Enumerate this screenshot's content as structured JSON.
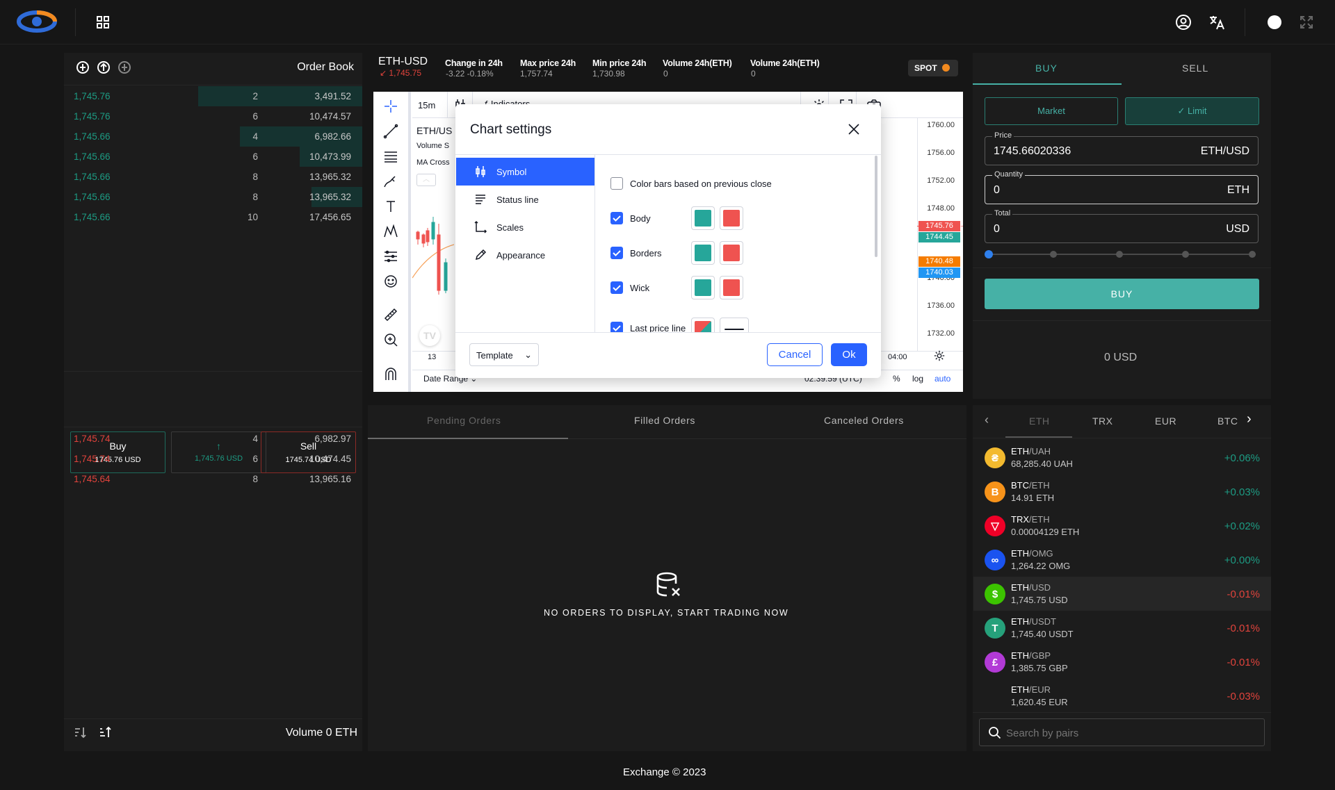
{
  "colors": {
    "green": "#1d9b83",
    "red": "#e0433c",
    "accent": "#2962ff",
    "teal": "#46b1a6"
  },
  "header": {
    "grid_icon": "grid-icon",
    "user_icon": "user-icon",
    "translate_icon": "translate-icon",
    "theme_icon": "theme-toggle",
    "expand_icon": "fullscreen-icon"
  },
  "orderbook": {
    "title": "Order Book",
    "bids": [
      {
        "price": "1,745.76",
        "qty": "2",
        "total": "3,491.52",
        "fill": 0.55
      },
      {
        "price": "1,745.76",
        "qty": "6",
        "total": "10,474.57",
        "fill": 0.0
      },
      {
        "price": "1,745.66",
        "qty": "4",
        "total": "6,982.66",
        "fill": 0.41
      },
      {
        "price": "1,745.66",
        "qty": "6",
        "total": "10,473.99",
        "fill": 0.21
      },
      {
        "price": "1,745.66",
        "qty": "8",
        "total": "13,965.32",
        "fill": 0.0
      },
      {
        "price": "1,745.66",
        "qty": "8",
        "total": "13,965.32",
        "fill": 0.17
      },
      {
        "price": "1,745.66",
        "qty": "10",
        "total": "17,456.65",
        "fill": 0.0
      }
    ],
    "asks": [
      {
        "price": "1,745.74",
        "qty": "4",
        "total": "6,982.97"
      },
      {
        "price": "1,745.74",
        "qty": "6",
        "total": "10,474.45"
      },
      {
        "price": "1,745.64",
        "qty": "8",
        "total": "13,965.16"
      }
    ],
    "buy_label": "Buy",
    "buy_price": "1745.76 USD",
    "mid_price": "1,745.76 USD",
    "sell_label": "Sell",
    "sell_price": "1745.74 USD",
    "volume": "Volume 0 ETH"
  },
  "market": {
    "pair": "ETH-USD",
    "last": "1,745.75",
    "change_label": "Change in 24h",
    "change_value": "-3.22 -0.18%",
    "max_label": "Max price 24h",
    "max_value": "1,757.74",
    "min_label": "Min price 24h",
    "min_value": "1,730.98",
    "vol_eth_label": "Volume 24h(ETH)",
    "vol_eth_value": "0",
    "vol2_label": "Volume 24h(ETH)",
    "vol2_value": "0",
    "spot": "SPOT"
  },
  "chart": {
    "interval": "15m",
    "indicators": "Indicators",
    "symbol": "ETH/US",
    "volume_label": "Volume S",
    "ma_label": "MA Cross",
    "ticks": [
      "1760.00",
      "1756.00",
      "1752.00",
      "1748.00",
      "1740.00",
      "1736.00",
      "1732.00"
    ],
    "tag_red": "1745.76",
    "tag_green": "1744.45",
    "tag_orange": "1740.48",
    "tag_blue": "1740.03",
    "x_left": "13",
    "x_right": "04:00",
    "date_range": "Date Range",
    "time_utc": "02:39:59 (UTC)",
    "pct": "%",
    "log": "log",
    "auto": "auto"
  },
  "dialog": {
    "title": "Chart settings",
    "nav": [
      "Symbol",
      "Status line",
      "Scales",
      "Appearance"
    ],
    "opt_color_bars": "Color bars based on previous close",
    "opt_body": "Body",
    "opt_borders": "Borders",
    "opt_wick": "Wick",
    "opt_last": "Last price line",
    "template": "Template",
    "cancel": "Cancel",
    "ok": "Ok"
  },
  "orders": {
    "tabs": [
      "Pending Orders",
      "Filled Orders",
      "Canceled Orders"
    ],
    "empty": "NO ORDERS TO DISPLAY, START TRADING NOW"
  },
  "trade": {
    "buy_tab": "BUY",
    "sell_tab": "SELL",
    "market": "Market",
    "limit": "Limit",
    "price_label": "Price",
    "price_value": "1745.66020336",
    "price_unit": "ETH/USD",
    "qty_label": "Quantity",
    "qty_value": "0",
    "qty_unit": "ETH",
    "total_label": "Total",
    "total_value": "0",
    "total_unit": "USD",
    "slider": 0,
    "buy_button": "BUY",
    "balance": "0 USD"
  },
  "markets": {
    "tabs": [
      "ETH",
      "TRX",
      "EUR",
      "BTC"
    ],
    "pairs": [
      {
        "base": "ETH",
        "quote": "/UAH",
        "price": "68,285.40 UAH",
        "change": "+0.06%",
        "up": true,
        "color": "#f3ba2f",
        "icon": "uah-coin-icon",
        "glyph": "₴"
      },
      {
        "base": "BTC",
        "quote": "/ETH",
        "price": "14.91 ETH",
        "change": "+0.03%",
        "up": true,
        "color": "#f7931a",
        "icon": "bitcoin-icon",
        "glyph": "B"
      },
      {
        "base": "TRX",
        "quote": "/ETH",
        "price": "0.00004129 ETH",
        "change": "+0.02%",
        "up": true,
        "color": "#ef0027",
        "icon": "tron-icon",
        "glyph": "▽"
      },
      {
        "base": "ETH",
        "quote": "/OMG",
        "price": "1,264.22 OMG",
        "change": "+0.00%",
        "up": true,
        "color": "#1a53f0",
        "icon": "omg-icon",
        "glyph": "∞"
      },
      {
        "base": "ETH",
        "quote": "/USD",
        "price": "1,745.75 USD",
        "change": "-0.01%",
        "up": false,
        "color": "#3cc300",
        "icon": "usd-icon",
        "glyph": "$"
      },
      {
        "base": "ETH",
        "quote": "/USDT",
        "price": "1,745.40 USDT",
        "change": "-0.01%",
        "up": false,
        "color": "#26a17b",
        "icon": "tether-icon",
        "glyph": "T"
      },
      {
        "base": "ETH",
        "quote": "/GBP",
        "price": "1,385.75 GBP",
        "change": "-0.01%",
        "up": false,
        "color": "#b23ad6",
        "icon": "gbp-icon",
        "glyph": "£"
      },
      {
        "base": "ETH",
        "quote": "/EUR",
        "price": "1,620.45 EUR",
        "change": "-0.03%",
        "up": false,
        "color": "",
        "icon": "",
        "glyph": ""
      }
    ],
    "search_placeholder": "Search by pairs"
  },
  "footer": "Exchange © 2023"
}
